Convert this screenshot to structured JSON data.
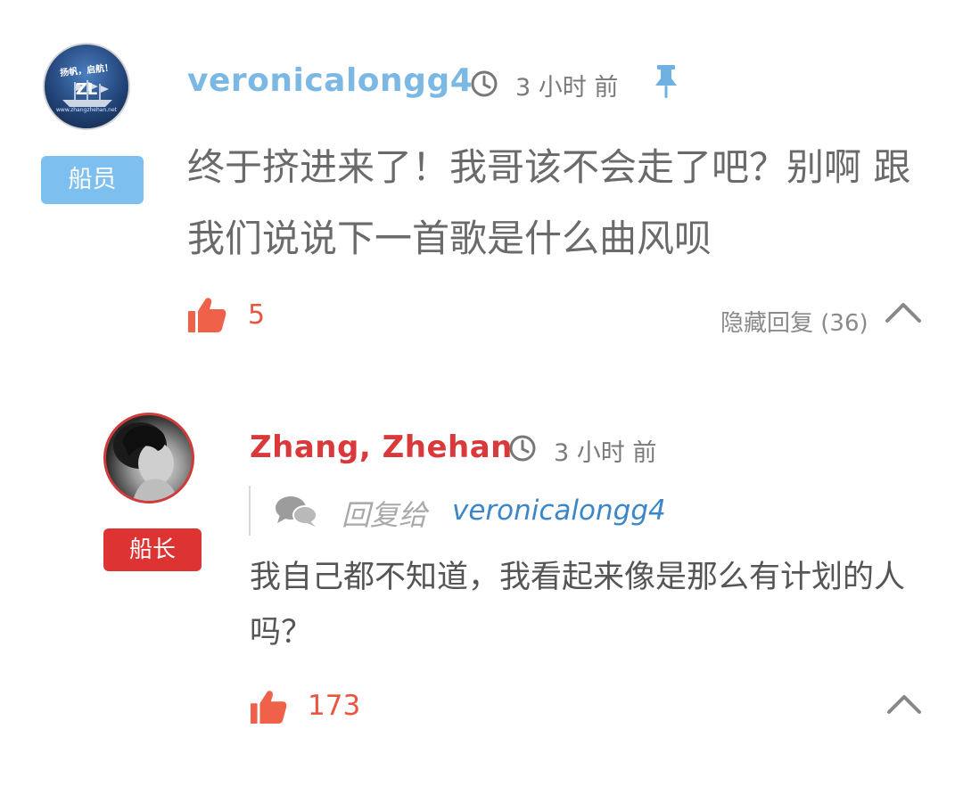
{
  "comment": {
    "author": "veronicalongg4",
    "role_badge": "船员",
    "time": "3 小时 前",
    "body": "终于挤进来了！我哥该不会走了吧？别啊 跟我们说说下一首歌是什么曲风呗",
    "likes": "5",
    "replies_toggle": "隐藏回复 (36)",
    "avatar_text": {
      "caption": "扬帆，启航！",
      "monogram": "ZL",
      "url": "www.zhangzhehan.net"
    },
    "icons": {
      "clock": "clock-icon",
      "pin": "pin-icon",
      "like": "thumbs-up-icon",
      "collapse": "chevron-up-icon"
    }
  },
  "reply": {
    "author": "Zhang, Zhehan",
    "role_badge": "船长",
    "time": "3 小时 前",
    "reply_to_label": "回复给",
    "reply_to_user": "veronicalongg4",
    "body": "我自己都不知道，我看起来像是那么有计划的人吗？",
    "likes": "173",
    "icons": {
      "clock": "clock-icon",
      "chat": "chat-bubbles-icon",
      "like": "thumbs-up-icon",
      "collapse": "chevron-up-icon"
    }
  },
  "colors": {
    "crew_blue": "#7dbfee",
    "captain_red": "#dd3333",
    "like_red": "#e8563f",
    "link_blue": "#3a86c8"
  }
}
